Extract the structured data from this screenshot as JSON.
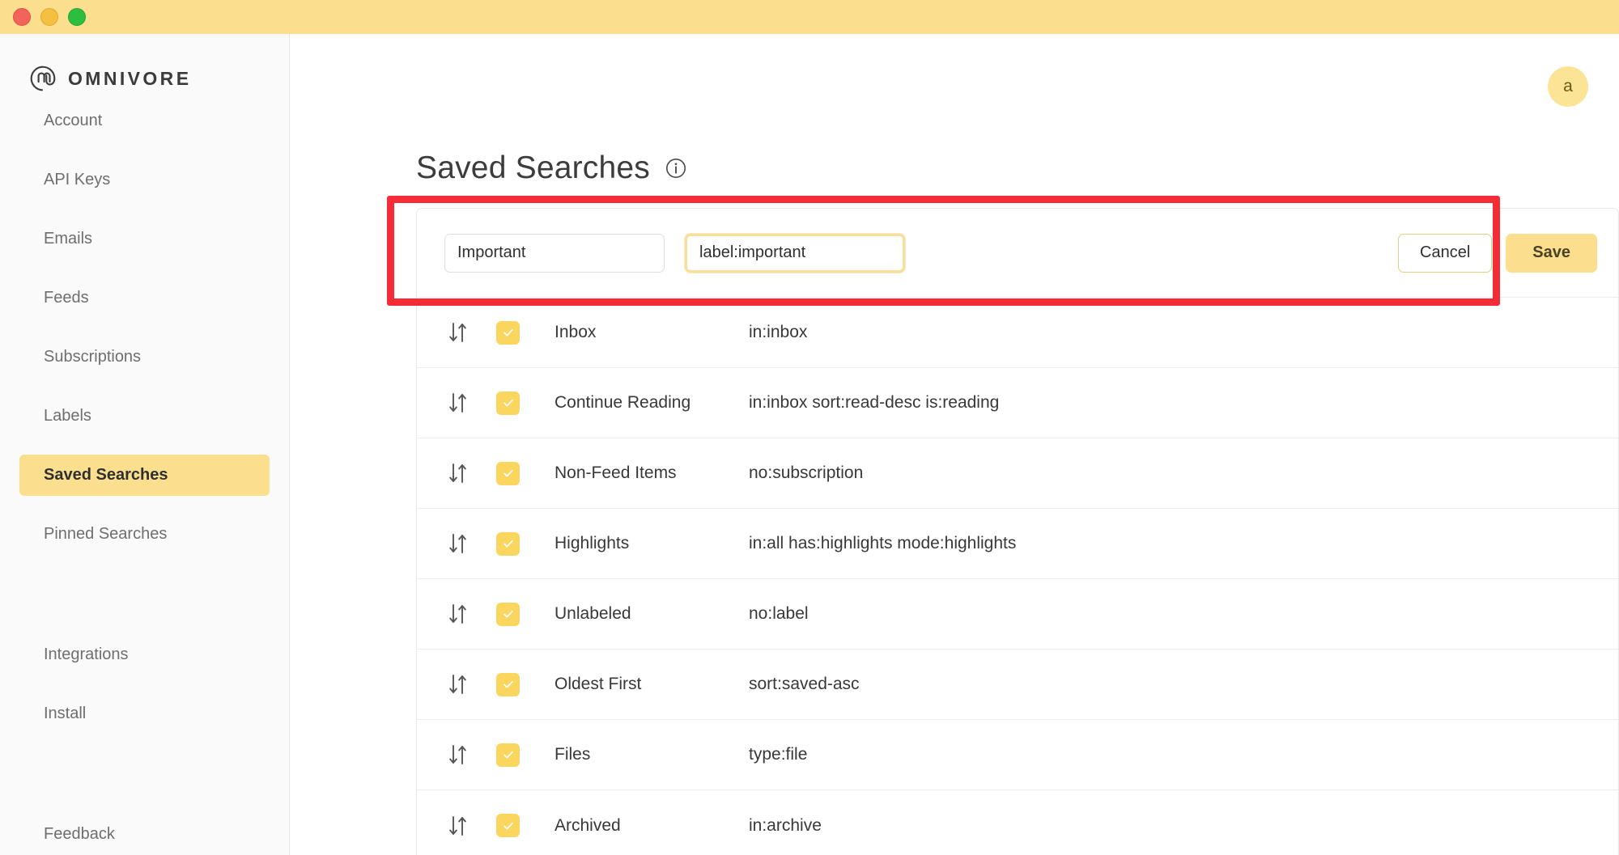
{
  "window": {
    "traffic_lights": [
      "close",
      "minimize",
      "maximize"
    ],
    "titlebar_color": "#fbdf8f"
  },
  "brand": {
    "name": "OMNIVORE",
    "logo_icon": "omnivore-logo-icon"
  },
  "sidebar": {
    "groups": [
      {
        "items": [
          {
            "label": "Account",
            "active": false
          },
          {
            "label": "API Keys",
            "active": false
          },
          {
            "label": "Emails",
            "active": false
          },
          {
            "label": "Feeds",
            "active": false
          },
          {
            "label": "Subscriptions",
            "active": false
          },
          {
            "label": "Labels",
            "active": false
          },
          {
            "label": "Saved Searches",
            "active": true
          },
          {
            "label": "Pinned Searches",
            "active": false
          }
        ]
      },
      {
        "items": [
          {
            "label": "Integrations",
            "active": false
          },
          {
            "label": "Install",
            "active": false
          }
        ]
      },
      {
        "items": [
          {
            "label": "Feedback",
            "active": false
          }
        ]
      }
    ]
  },
  "header": {
    "avatar_initial": "a",
    "avatar_bg": "#fbe496"
  },
  "page": {
    "title": "Saved Searches",
    "info_icon": "info-circle-icon"
  },
  "edit_row": {
    "name_value": "Important",
    "name_placeholder": "Name",
    "query_value": "label:important",
    "query_placeholder": "Search Query",
    "cancel_label": "Cancel",
    "save_label": "Save",
    "highlight_color": "#f42c36",
    "focus_border_color": "#f7df9e"
  },
  "table": {
    "checkbox_color": "#fbd65f",
    "rows": [
      {
        "handle_icon": "reorder-arrows-icon",
        "checked": true,
        "name": "Inbox",
        "query": "in:inbox"
      },
      {
        "handle_icon": "reorder-arrows-icon",
        "checked": true,
        "name": "Continue Reading",
        "query": "in:inbox sort:read-desc is:reading"
      },
      {
        "handle_icon": "reorder-arrows-icon",
        "checked": true,
        "name": "Non-Feed Items",
        "query": "no:subscription"
      },
      {
        "handle_icon": "reorder-arrows-icon",
        "checked": true,
        "name": "Highlights",
        "query": "in:all has:highlights mode:highlights"
      },
      {
        "handle_icon": "reorder-arrows-icon",
        "checked": true,
        "name": "Unlabeled",
        "query": "no:label"
      },
      {
        "handle_icon": "reorder-arrows-icon",
        "checked": true,
        "name": "Oldest First",
        "query": "sort:saved-asc"
      },
      {
        "handle_icon": "reorder-arrows-icon",
        "checked": true,
        "name": "Files",
        "query": "type:file"
      },
      {
        "handle_icon": "reorder-arrows-icon",
        "checked": true,
        "name": "Archived",
        "query": "in:archive"
      }
    ]
  }
}
